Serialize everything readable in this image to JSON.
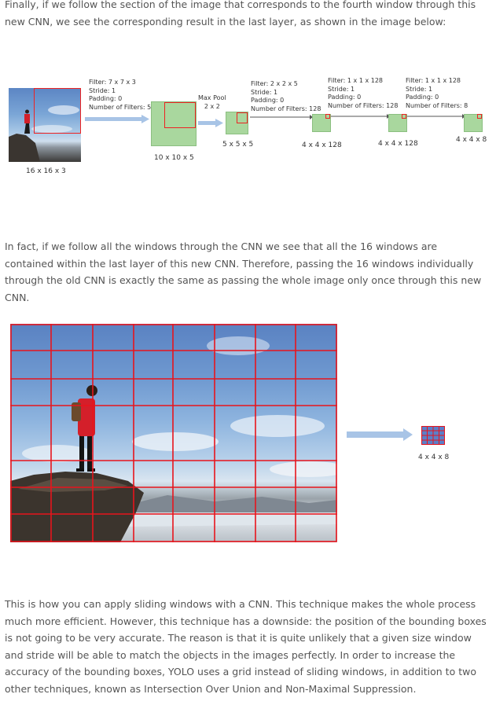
{
  "paragraphs": {
    "p1": "Finally, if we follow the section of the image that corresponds to the fourth window through this new CNN, we see the corresponding result in the last layer, as shown in the image below:",
    "p2": "In fact, if we follow all the windows through the CNN we see that all the 16 windows are contained within the last layer of this new CNN. Therefore, passing the 16 windows individually through the old CNN is exactly the same as passing the whole image only once through this new CNN.",
    "p3": "This is how you can apply sliding windows with a CNN. This technique makes the whole process much more efficient. However, this technique has a downside: the position of the bounding boxes is not going to be very accurate. The reason is that it is quite unlikely that a given size window and stride will be able to match the objects in the images perfectly. In order to increase the accuracy of the bounding boxes, YOLO uses a grid instead of sliding windows, in addition to two other techniques, known as Intersection Over Union and Non-Maximal Suppression."
  },
  "diagram": {
    "input_dim": "16 x 16 x 3",
    "layer1": {
      "filter": "Filter: 7 x 7 x 3",
      "stride": "Stride: 1",
      "padding": "Padding: 0",
      "filters": "Number of Filters: 5",
      "dim": "10 x 10 x 5"
    },
    "pool": {
      "name": "Max Pool",
      "size": "2 x 2",
      "dim": "5 x 5 x 5"
    },
    "layer2": {
      "filter": "Filter: 2 x 2 x 5",
      "stride": "Stride: 1",
      "padding": "Padding: 0",
      "filters": "Number of Filters: 128",
      "dim": "4 x 4 x 128"
    },
    "layer3": {
      "filter": "Filter: 1 x 1 x 128",
      "stride": "Stride: 1",
      "padding": "Padding: 0",
      "filters": "Number of Filters: 128",
      "dim": "4 x 4 x 128"
    },
    "layer4": {
      "filter": "Filter: 1 x 1 x 128",
      "stride": "Stride: 1",
      "padding": "Padding: 0",
      "filters": "Number of Filters: 8",
      "dim": "4 x 4 x 8"
    }
  },
  "grid_figure": {
    "output_dim": "4 x 4 x 8",
    "grid_color": "#e8141c",
    "arrow_color": "#a8c4e6",
    "output_grid_color": "#7b61c9"
  }
}
